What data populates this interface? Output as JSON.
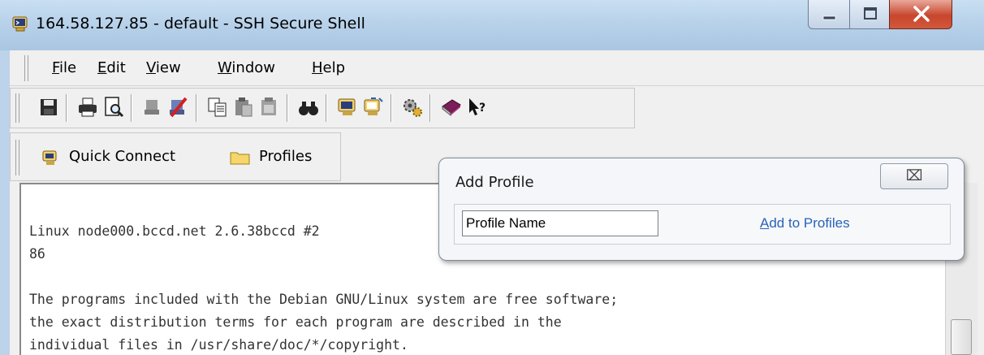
{
  "window": {
    "title": "164.58.127.85 - default - SSH Secure Shell",
    "icons": {
      "app": "ssh-terminal-icon",
      "minimize": "minimize-icon",
      "maximize": "maximize-icon",
      "close": "close-x-icon"
    }
  },
  "menu": {
    "items": [
      {
        "mnemonic": "F",
        "rest": "ile"
      },
      {
        "mnemonic": "E",
        "rest": "dit"
      },
      {
        "mnemonic": "V",
        "rest": "iew"
      },
      {
        "mnemonic": "W",
        "rest": "indow"
      },
      {
        "mnemonic": "H",
        "rest": "elp"
      }
    ]
  },
  "toolbar": {
    "icons": [
      "save-icon",
      "print-icon",
      "print-preview-icon",
      "disconnect-icon",
      "disconnect-red-icon",
      "copy-icon",
      "paste-icon",
      "paste-disabled-icon",
      "find-icon",
      "new-terminal-icon",
      "new-file-transfer-icon",
      "settings-icon",
      "help-book-icon",
      "whats-this-icon"
    ]
  },
  "quickbar": {
    "quick_connect": "Quick Connect",
    "profiles": "Profiles"
  },
  "terminal": {
    "lines": [
      "Linux node000.bccd.net 2.6.38bccd #2",
      "86",
      "",
      "The programs included with the Debian GNU/Linux system are free software;",
      "the exact distribution terms for each program are described in the",
      "individual files in /usr/share/doc/*/copyright."
    ]
  },
  "popup": {
    "title": "Add Profile",
    "close_glyph": "⌧",
    "input_value": "Profile Name",
    "link_mnemonic": "A",
    "link_rest": "dd to Profiles"
  },
  "colors": {
    "titlebar": "#b8d2ea",
    "close_button": "#c8462d",
    "link": "#2a62b8",
    "terminal_text": "#333333"
  }
}
